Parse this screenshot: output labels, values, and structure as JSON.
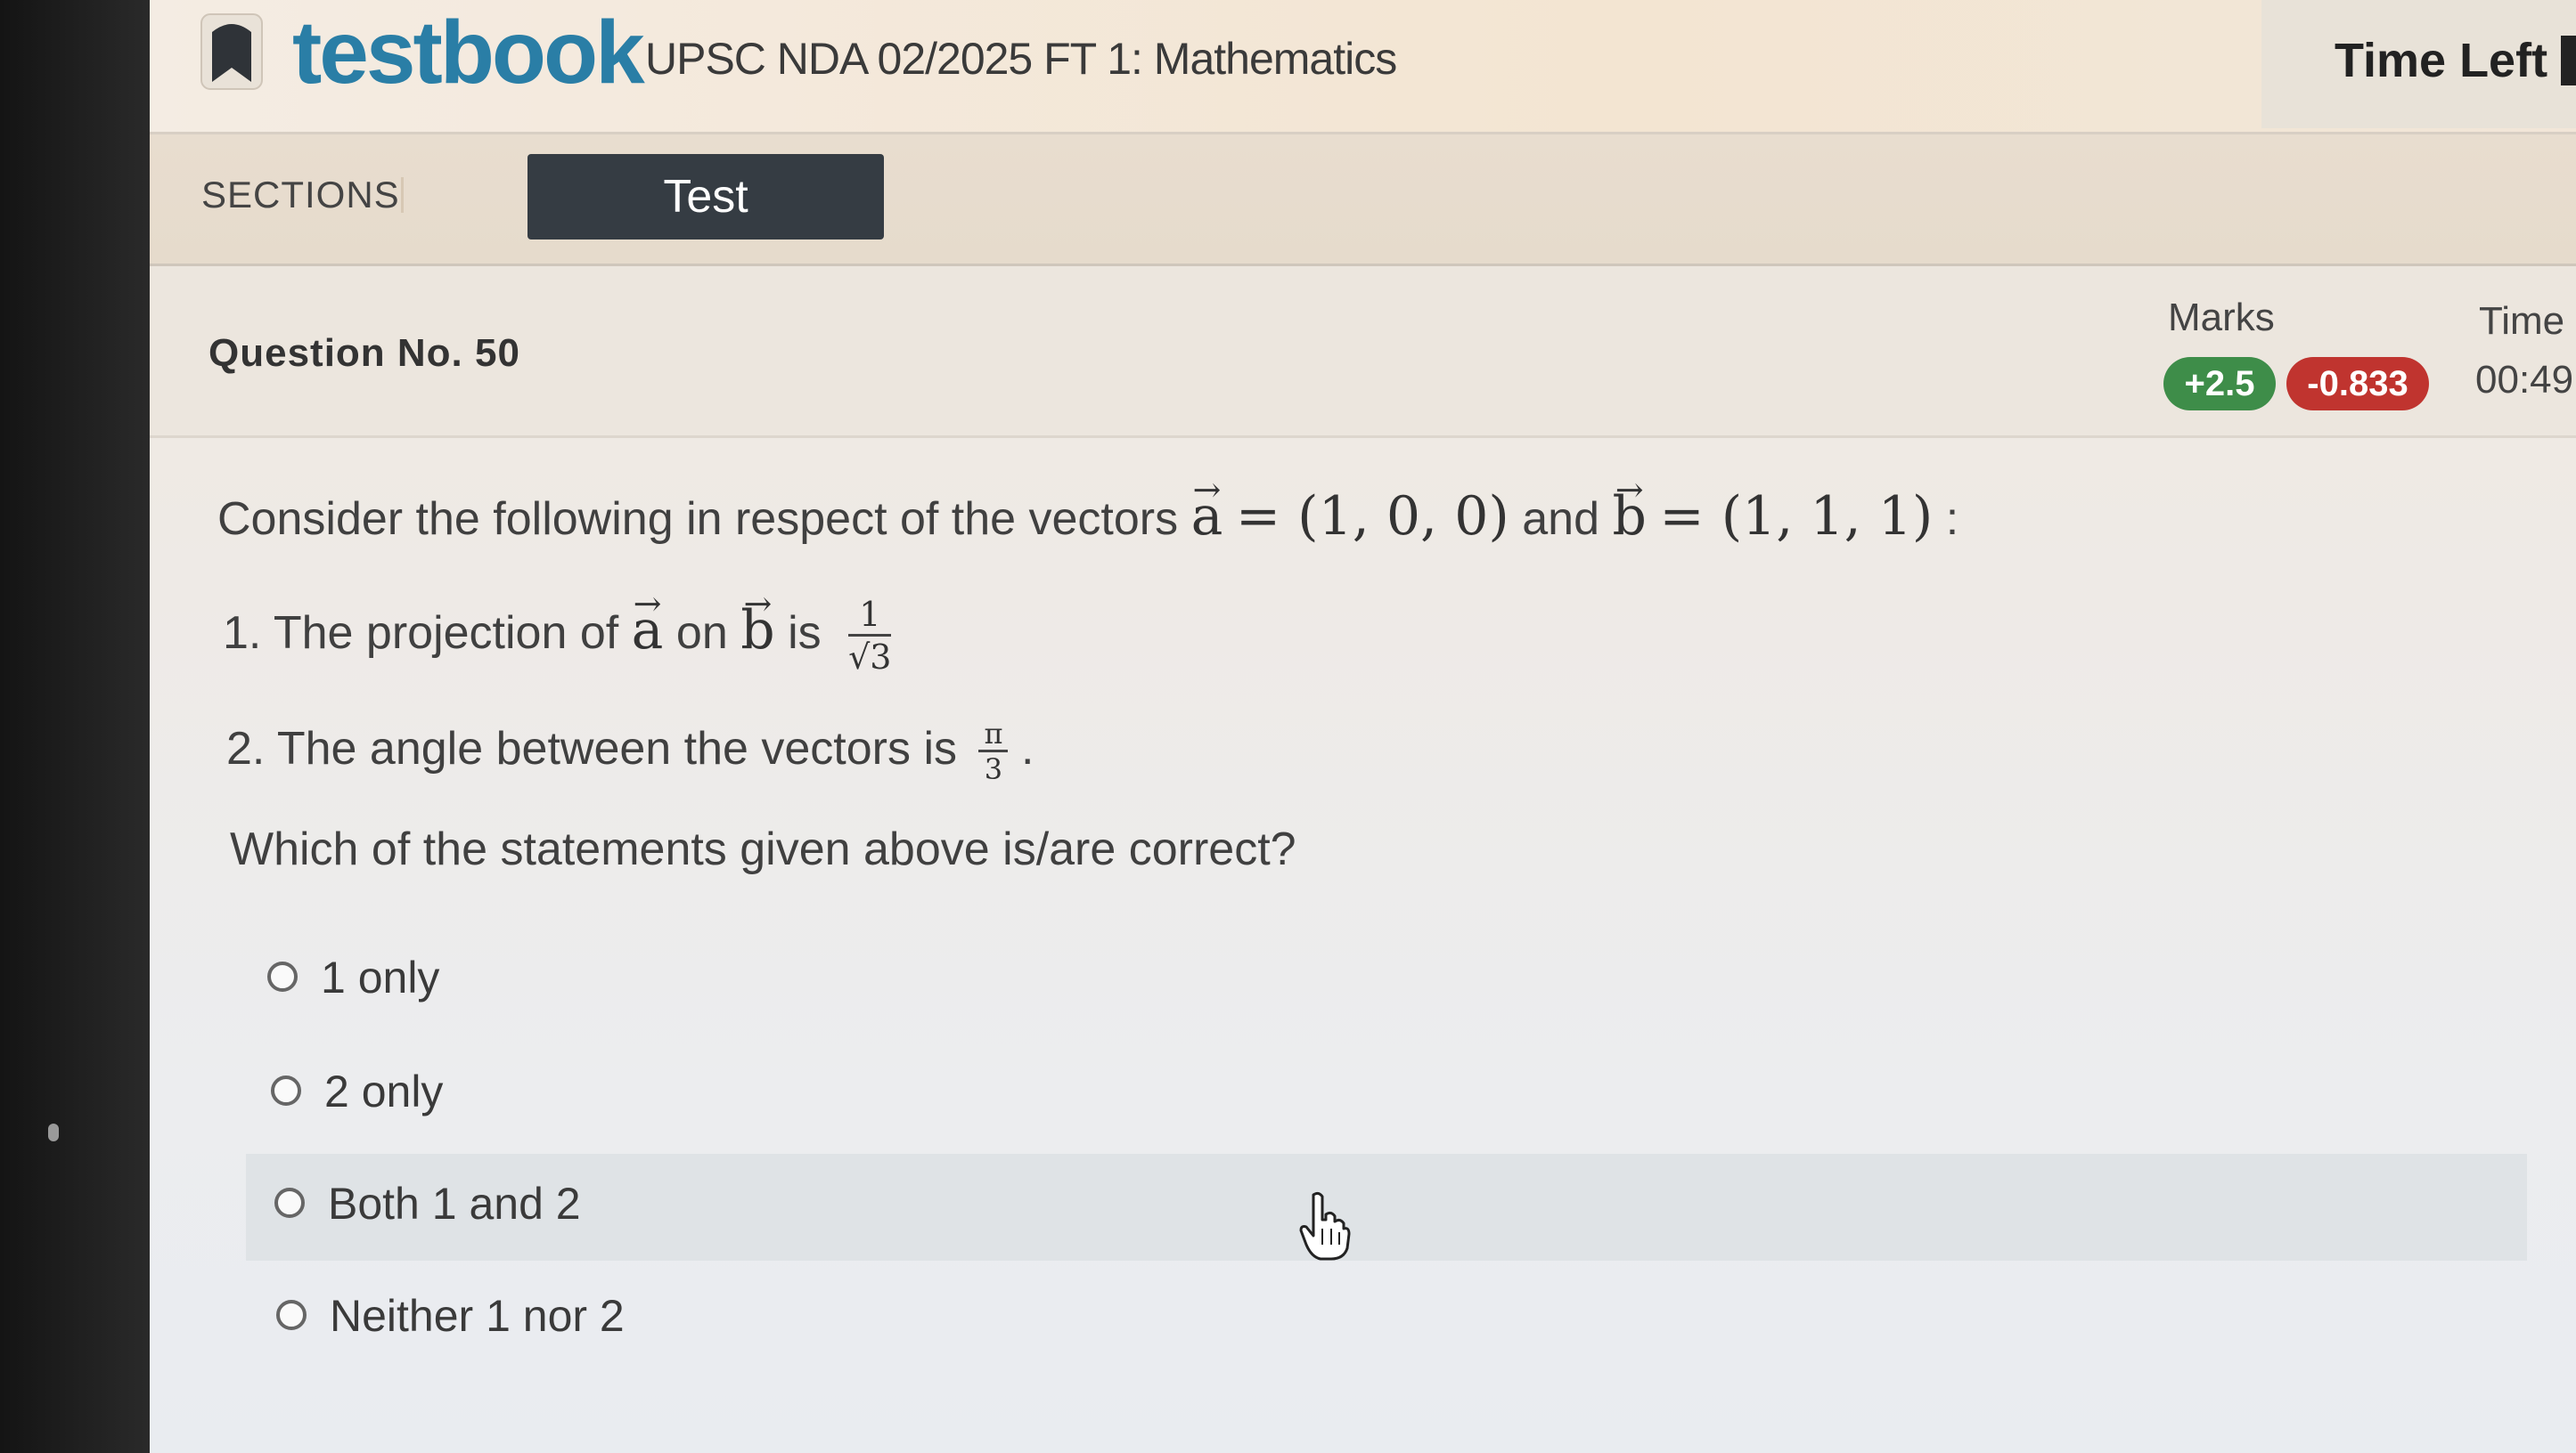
{
  "header": {
    "logo_text": "testbook",
    "test_name": "UPSC NDA 02/2025 FT 1: Mathematics",
    "time_left_label": "Time Left"
  },
  "sections": {
    "label": "SECTIONS",
    "tabs": [
      {
        "label": "Test",
        "active": true
      }
    ]
  },
  "question": {
    "number_label": "Question No. 50",
    "marks_label": "Marks",
    "positive_marks": "+2.5",
    "negative_marks": "-0.833",
    "time_label": "Time",
    "time_value": "00:49",
    "intro": {
      "prefix": "Consider the following in respect of the vectors",
      "a_def": "= (1, 0, 0)",
      "and": "and",
      "b_def": "= (1, 1, 1)",
      "suffix": ":"
    },
    "statement1": {
      "prefix": "1. The projection of",
      "on": "on",
      "is": "is",
      "frac_num": "1",
      "frac_den": "√3"
    },
    "statement2": {
      "prefix": "2. The angle between the vectors is",
      "frac_num": "π",
      "frac_den": "3",
      "suffix": "."
    },
    "prompt": "Which of the statements given above is/are correct?",
    "vec_a": "a",
    "vec_b": "b"
  },
  "options": [
    {
      "label": "1 only"
    },
    {
      "label": "2 only"
    },
    {
      "label": "Both 1 and 2"
    },
    {
      "label": "Neither 1 nor 2"
    }
  ],
  "colors": {
    "brand": "#2a7ea6",
    "active_tab": "#353c43",
    "positive_badge": "#3e8d49",
    "negative_badge": "#c0342f"
  },
  "icons": {
    "logo": "testbook-bookmark-icon",
    "cursor": "hand-pointer-icon"
  }
}
